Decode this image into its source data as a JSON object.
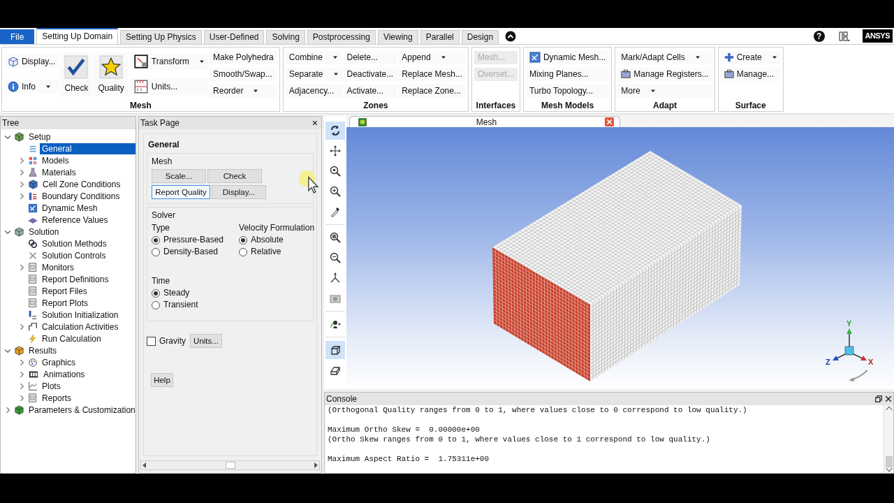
{
  "tabs": [
    {
      "label": "File",
      "kind": "file",
      "selected": false
    },
    {
      "label": "Setting Up Domain",
      "kind": "tab",
      "selected": true
    },
    {
      "label": "Setting Up Physics",
      "kind": "tab",
      "selected": false
    },
    {
      "label": "User-Defined",
      "kind": "tab",
      "selected": false
    },
    {
      "label": "Solving",
      "kind": "tab",
      "selected": false
    },
    {
      "label": "Postprocessing",
      "kind": "tab",
      "selected": false
    },
    {
      "label": "Viewing",
      "kind": "tab",
      "selected": false
    },
    {
      "label": "Parallel",
      "kind": "tab",
      "selected": false
    },
    {
      "label": "Design",
      "kind": "tab",
      "selected": false
    }
  ],
  "help": "?",
  "logo": "ANSYS",
  "ribbon": [
    {
      "title": "Mesh",
      "columns": [
        [
          {
            "label": "Display...",
            "kind": "icon"
          },
          {
            "label": "Info",
            "kind": "icon",
            "menu": true
          }
        ],
        [
          {
            "label": "Check",
            "kind": "large"
          }
        ],
        [
          {
            "label": "Quality",
            "kind": "large"
          }
        ],
        [
          {
            "label": "Transform",
            "kind": "icon",
            "menu": true
          },
          {
            "label": "Units...",
            "kind": "icon"
          }
        ],
        [
          {
            "label": "Make Polyhedra",
            "kind": "text"
          },
          {
            "label": "Smooth/Swap...",
            "kind": "text"
          },
          {
            "label": "Reorder",
            "kind": "text",
            "menu": true
          }
        ]
      ]
    },
    {
      "title": "Zones",
      "columns": [
        [
          {
            "label": "Combine",
            "kind": "text",
            "menu": true
          },
          {
            "label": "Separate",
            "kind": "text",
            "menu": true
          },
          {
            "label": "Adjacency...",
            "kind": "text"
          }
        ],
        [
          {
            "label": "Delete...",
            "kind": "text"
          },
          {
            "label": "Deactivate...",
            "kind": "text"
          },
          {
            "label": "Activate...",
            "kind": "text"
          }
        ],
        [
          {
            "label": "Append",
            "kind": "text",
            "menu": true
          },
          {
            "label": "Replace Mesh...",
            "kind": "text"
          },
          {
            "label": "Replace Zone...",
            "kind": "text"
          }
        ]
      ]
    },
    {
      "title": "Interfaces",
      "columns": [
        [
          {
            "label": "Mesh...",
            "kind": "text",
            "disabled": true
          },
          {
            "label": "Overset...",
            "kind": "text",
            "disabled": true
          },
          {
            "kind": "spacer"
          }
        ]
      ]
    },
    {
      "title": "Mesh Models",
      "columns": [
        [
          {
            "label": "Dynamic Mesh...",
            "kind": "icon"
          },
          {
            "label": "Mixing Planes...",
            "kind": "text"
          },
          {
            "label": "Turbo Topology...",
            "kind": "text"
          }
        ]
      ]
    },
    {
      "title": "Adapt",
      "columns": [
        [
          {
            "label": "Mark/Adapt Cells",
            "kind": "text",
            "menu": true
          },
          {
            "label": "Manage Registers...",
            "kind": "icon"
          },
          {
            "label": "More",
            "kind": "text",
            "menu": true
          }
        ]
      ]
    },
    {
      "title": "Surface",
      "columns": [
        [
          {
            "label": "Create",
            "kind": "icon",
            "menu": true
          },
          {
            "label": "Manage...",
            "kind": "icon"
          },
          {
            "kind": "spacer"
          }
        ]
      ]
    }
  ],
  "tree": {
    "title": "Tree",
    "items": [
      {
        "label": "Setup",
        "expanded": true,
        "selected": false,
        "children": [
          {
            "label": "General",
            "selected": true
          },
          {
            "label": "Models",
            "expanded": false,
            "selected": false
          },
          {
            "label": "Materials",
            "expanded": false,
            "selected": false
          },
          {
            "label": "Cell Zone Conditions",
            "expanded": false,
            "selected": false
          },
          {
            "label": "Boundary Conditions",
            "expanded": false,
            "selected": false
          },
          {
            "label": "Dynamic Mesh",
            "selected": false
          },
          {
            "label": "Reference Values",
            "selected": false
          }
        ]
      },
      {
        "label": "Solution",
        "expanded": true,
        "selected": false,
        "children": [
          {
            "label": "Solution Methods",
            "selected": false
          },
          {
            "label": "Solution Controls",
            "selected": false
          },
          {
            "label": "Monitors",
            "expanded": false,
            "selected": false
          },
          {
            "label": "Report Definitions",
            "selected": false
          },
          {
            "label": "Report Files",
            "selected": false
          },
          {
            "label": "Report Plots",
            "selected": false
          },
          {
            "label": "Solution Initialization",
            "selected": false
          },
          {
            "label": "Calculation Activities",
            "expanded": false,
            "selected": false
          },
          {
            "label": "Run Calculation",
            "selected": false
          }
        ]
      },
      {
        "label": "Results",
        "expanded": true,
        "selected": false,
        "children": [
          {
            "label": "Graphics",
            "expanded": false,
            "selected": false
          },
          {
            "label": "Animations",
            "expanded": false,
            "selected": false
          },
          {
            "label": "Plots",
            "expanded": false,
            "selected": false
          },
          {
            "label": "Reports",
            "expanded": false,
            "selected": false
          }
        ]
      },
      {
        "label": "Parameters & Customization",
        "expanded": false,
        "selected": false
      }
    ]
  },
  "task_page": {
    "title": "Task Page",
    "close": "×",
    "heading": "General",
    "mesh": {
      "title": "Mesh",
      "buttons": [
        {
          "label": "Scale...",
          "focused": false
        },
        {
          "label": "Check",
          "focused": false
        },
        {
          "label": "Report Quality",
          "focused": true
        },
        {
          "label": "Display...",
          "focused": false
        }
      ]
    },
    "solver": {
      "title": "Solver",
      "groups": [
        {
          "title": "Type",
          "options": [
            {
              "label": "Pressure-Based",
              "selected": true
            },
            {
              "label": "Density-Based",
              "selected": false
            }
          ]
        },
        {
          "title": "Velocity Formulation",
          "options": [
            {
              "label": "Absolute",
              "selected": true
            },
            {
              "label": "Relative",
              "selected": false
            }
          ]
        },
        {
          "title": "Time",
          "options": [
            {
              "label": "Steady",
              "selected": true
            },
            {
              "label": "Transient",
              "selected": false
            }
          ]
        }
      ]
    },
    "gravity": {
      "label": "Gravity",
      "checked": false
    },
    "units_button": "Units...",
    "help_button": "Help"
  },
  "graphics": {
    "toolbar": [
      {
        "selected": true
      },
      {
        "selected": false
      },
      {
        "selected": false
      },
      {
        "selected": false
      },
      {
        "selected": false
      },
      {
        "selected": false
      },
      {
        "selected": false
      },
      {
        "selected": false
      },
      {
        "selected": false
      },
      {
        "selected": false
      },
      {
        "selected": true
      },
      {
        "selected": false
      }
    ],
    "window": {
      "title": "Mesh"
    },
    "axes": [
      "Y",
      "X",
      "Z"
    ]
  },
  "console": {
    "title": "Console",
    "blocks": [
      [
        "(Orthogonal Quality ranges from 0 to 1, where values close to 0 correspond to low quality.)"
      ],
      [
        "Maximum Ortho Skew =  0.00000e+00",
        "(Ortho Skew ranges from 0 to 1, where values close to 1 correspond to low quality.)"
      ],
      [
        "Maximum Aspect Ratio =  1.75311e+00"
      ]
    ]
  }
}
